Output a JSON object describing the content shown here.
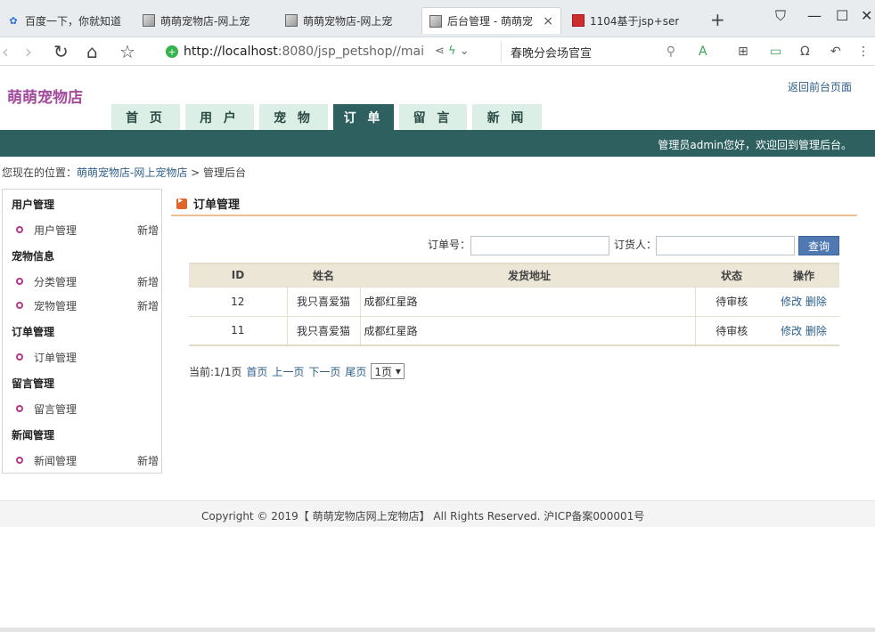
{
  "browser": {
    "tabs": [
      {
        "label": "百度一下，你就知道",
        "icon": "baidu-paw-icon"
      },
      {
        "label": "萌萌宠物店-网上宠",
        "icon": "page-image-icon"
      },
      {
        "label": "萌萌宠物店-网上宠",
        "icon": "page-image-icon"
      },
      {
        "label": "后台管理 - 萌萌宠",
        "icon": "page-image-icon",
        "active": true
      },
      {
        "label": "1104基于jsp+ser",
        "icon": "red-favicon-icon"
      }
    ],
    "close_glyph": "×",
    "new_tab_glyph": "+",
    "url_host": "http://localhost",
    "url_rest": ":8080/jsp_petshop//mai",
    "search_text": "春晚分会场官宣"
  },
  "site": {
    "title": "萌萌宠物店",
    "back_link": "返回前台页面",
    "nav": [
      "首 页",
      "用 户",
      "宠 物",
      "订 单",
      "留 言",
      "新 闻"
    ],
    "active_nav_index": 3,
    "welcome": "管理员admin您好，欢迎回到管理后台。"
  },
  "breadcrumb": {
    "prefix": "您现在的位置：",
    "link": "萌萌宠物店-网上宠物店",
    "sep": " > ",
    "current": "管理后台"
  },
  "sidebar": {
    "groups": [
      {
        "title": "用户管理",
        "items": [
          {
            "label": "用户管理",
            "add": "新增"
          }
        ]
      },
      {
        "title": "宠物信息",
        "items": [
          {
            "label": "分类管理",
            "add": "新增"
          },
          {
            "label": "宠物管理",
            "add": "新增"
          }
        ]
      },
      {
        "title": "订单管理",
        "items": [
          {
            "label": "订单管理",
            "add": ""
          }
        ]
      },
      {
        "title": "留言管理",
        "items": [
          {
            "label": "留言管理",
            "add": ""
          }
        ]
      },
      {
        "title": "新闻管理",
        "items": [
          {
            "label": "新闻管理",
            "add": "新增"
          }
        ]
      }
    ]
  },
  "main": {
    "panel_title": "订单管理",
    "filter": {
      "order_no_label": "订单号：",
      "order_no_value": "",
      "buyer_label": "订货人：",
      "buyer_value": "",
      "query_button": "查询"
    },
    "table": {
      "headers": [
        "ID",
        "姓名",
        "发货地址",
        "状态",
        "操作"
      ],
      "rows": [
        {
          "id": "12",
          "name": "我只喜爱猫",
          "address": "成都红星路",
          "status": "待审核",
          "edit": "修改",
          "delete": "删除"
        },
        {
          "id": "11",
          "name": "我只喜爱猫",
          "address": "成都红星路",
          "status": "待审核",
          "edit": "修改",
          "delete": "删除"
        }
      ]
    },
    "pager": {
      "current": "当前:1/1页",
      "first": "首页",
      "prev": "上一页",
      "next": "下一页",
      "last": "尾页",
      "select_value": "1页"
    }
  },
  "footer": {
    "copyright": "Copyright © 2019【 萌萌宠物店网上宠物店】 All Rights Reserved. 沪ICP备案000001号"
  }
}
